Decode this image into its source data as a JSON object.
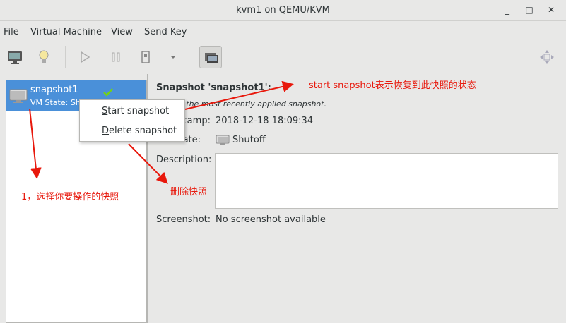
{
  "window": {
    "title": "kvm1 on QEMU/KVM",
    "minimize": "_",
    "maximize": "□",
    "close": "✕"
  },
  "menubar": {
    "items": [
      "File",
      "Virtual Machine",
      "View",
      "Send Key"
    ]
  },
  "toolbar": {
    "buttons": [
      "monitor-icon",
      "lightbulb-icon",
      "run-icon",
      "pause-icon",
      "shutdown-icon",
      "dropdown-arrow-icon",
      "snapshots-icon"
    ],
    "right_icon": "fullscreen-icon"
  },
  "snapshot_list": {
    "items": [
      {
        "name": "snapshot1",
        "state": "VM State: Shutoff",
        "current": true
      }
    ]
  },
  "details": {
    "title": "Snapshot 'snapshot1':",
    "status": "Status: the most recently applied snapshot.",
    "timestamp_label": "Timestamp:",
    "timestamp": "2018-12-18 18:09:34",
    "vm_state_label": "VM State:",
    "vm_state": "Shutoff",
    "description_label": "Description:",
    "description": "",
    "screenshot_label": "Screenshot:",
    "screenshot": "No screenshot available"
  },
  "context_menu": {
    "start_mnemonic": "S",
    "start_rest": "tart snapshot",
    "delete_mnemonic": "D",
    "delete_rest": "elete snapshot"
  },
  "annotations": {
    "start": "start snapshot表示恢复到此快照的状态",
    "delete": "删除快照",
    "select": "1，选择你要操作的快照"
  },
  "colors": {
    "selection": "#4a90d9",
    "annotation": "#e8180c",
    "checkmark": "#73d216"
  }
}
